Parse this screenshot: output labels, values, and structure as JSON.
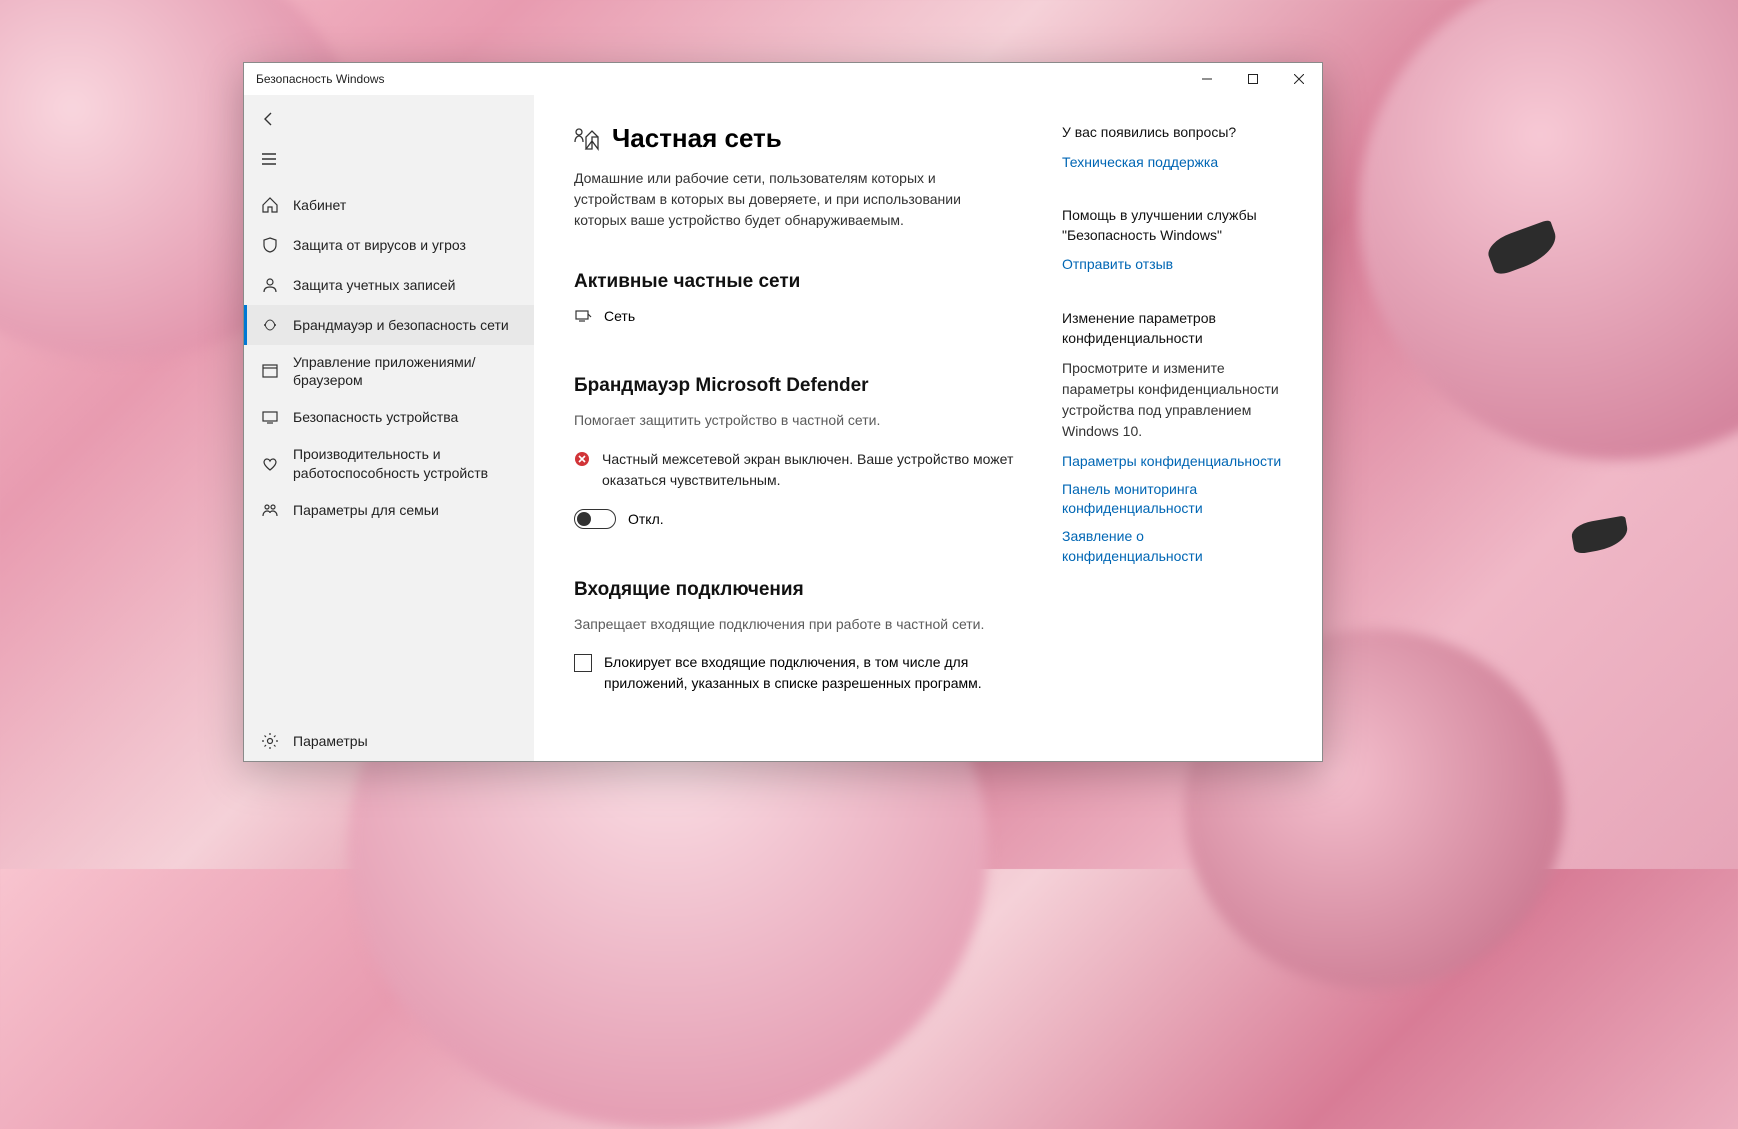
{
  "window": {
    "title": "Безопасность Windows"
  },
  "nav": {
    "items": [
      {
        "label": "Кабинет"
      },
      {
        "label": "Защита от вирусов и угроз"
      },
      {
        "label": "Защита учетных записей"
      },
      {
        "label": "Брандмауэр и безопасность сети"
      },
      {
        "label": "Управление приложениями/браузером"
      },
      {
        "label": "Безопасность устройства"
      },
      {
        "label": "Производительность и работоспособность устройств"
      },
      {
        "label": "Параметры для семьи"
      }
    ],
    "settings": "Параметры"
  },
  "page": {
    "title": "Частная сеть",
    "intro": "Домашние или рабочие сети, пользователям которых и устройствам в которых вы доверяете, и при использовании которых ваше устройство будет обнаруживаемым.",
    "active_section": "Активные частные сети",
    "active_network": "Сеть",
    "fw_section": "Брандмауэр Microsoft Defender",
    "fw_desc": "Помогает защитить устройство в частной сети.",
    "fw_warning": "Частный межсетевой экран выключен. Ваше устройство может оказаться чувствительным.",
    "toggle_state": "Откл.",
    "incoming_section": "Входящие подключения",
    "incoming_desc": "Запрещает входящие подключения при работе в частной сети.",
    "incoming_check": "Блокирует все входящие подключения, в том числе для приложений, указанных в списке разрешенных программ."
  },
  "aside": {
    "help_title": "У вас появились вопросы?",
    "help_link": "Техническая поддержка",
    "improve_title": "Помощь в улучшении службы \"Безопасность Windows\"",
    "improve_link": "Отправить отзыв",
    "privacy_title": "Изменение параметров конфиденциальности",
    "privacy_desc": "Просмотрите и измените параметры конфиденциальности устройства под управлением Windows 10.",
    "privacy_link1": "Параметры конфиденциальности",
    "privacy_link2": "Панель мониторинга конфиденциальности",
    "privacy_link3": "Заявление о конфиденциальности"
  }
}
